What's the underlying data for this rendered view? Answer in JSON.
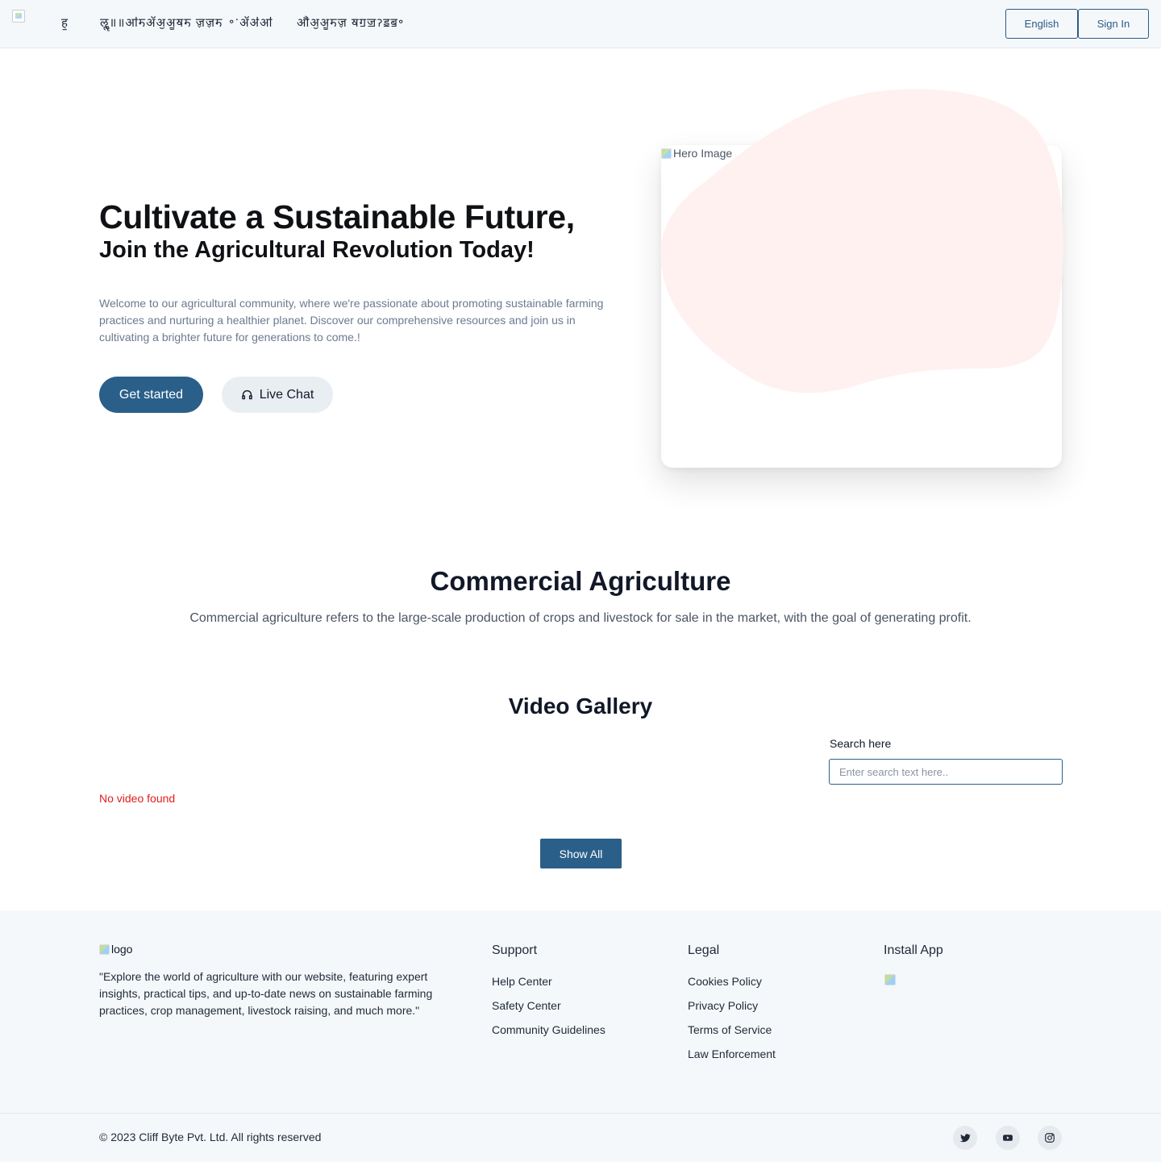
{
  "header": {
    "nav": [
      "ह॒",
      "ॡॢ॥॥ॴॸॲॶॷॺॸ ॹॹॸ",
      "॰ॱॲॳॴ",
      "ॵॶॷॸॹ ॺॻॼॽॾॿ॰"
    ],
    "language_button": "English",
    "signin_button": "Sign In"
  },
  "hero": {
    "title": "Cultivate a Sustainable Future,",
    "subtitle": "Join the Agricultural Revolution Today!",
    "description": "Welcome to our agricultural community, where we're passionate about promoting sustainable farming practices and nurturing a healthier planet. Discover our comprehensive resources and join us in cultivating a brighter future for generations to come.!",
    "primary_button": "Get started",
    "chat_button": "Live Chat",
    "image_alt": "Hero Image",
    "blob_color": "#fff1f0"
  },
  "commercial": {
    "title": "Commercial Agriculture",
    "description": "Commercial agriculture refers to the large-scale production of crops and livestock for sale in the market, with the goal of generating profit."
  },
  "video_gallery": {
    "title": "Video Gallery",
    "search_label": "Search here",
    "search_placeholder": "Enter search text here..",
    "empty_message": "No video found",
    "show_all_button": "Show All"
  },
  "footer": {
    "logo_alt": "logo",
    "about": "\"Explore the world of agriculture with our website, featuring expert insights, practical tips, and up-to-date news on sustainable farming practices, crop management, livestock raising, and much more.\"",
    "support": {
      "title": "Support",
      "links": [
        "Help Center",
        "Safety Center",
        "Community Guidelines"
      ]
    },
    "legal": {
      "title": "Legal",
      "links": [
        "Cookies Policy",
        "Privacy Policy",
        "Terms of Service",
        "Law Enforcement"
      ]
    },
    "install": {
      "title": "Install App"
    },
    "copyright": "© 2023 Cliff Byte Pvt. Ltd. All rights reserved",
    "social": [
      "twitter-icon",
      "youtube-icon",
      "instagram-icon"
    ]
  },
  "colors": {
    "primary": "#2a5f8a",
    "header_bg": "#f5f8fb",
    "error": "#e11d1d"
  }
}
